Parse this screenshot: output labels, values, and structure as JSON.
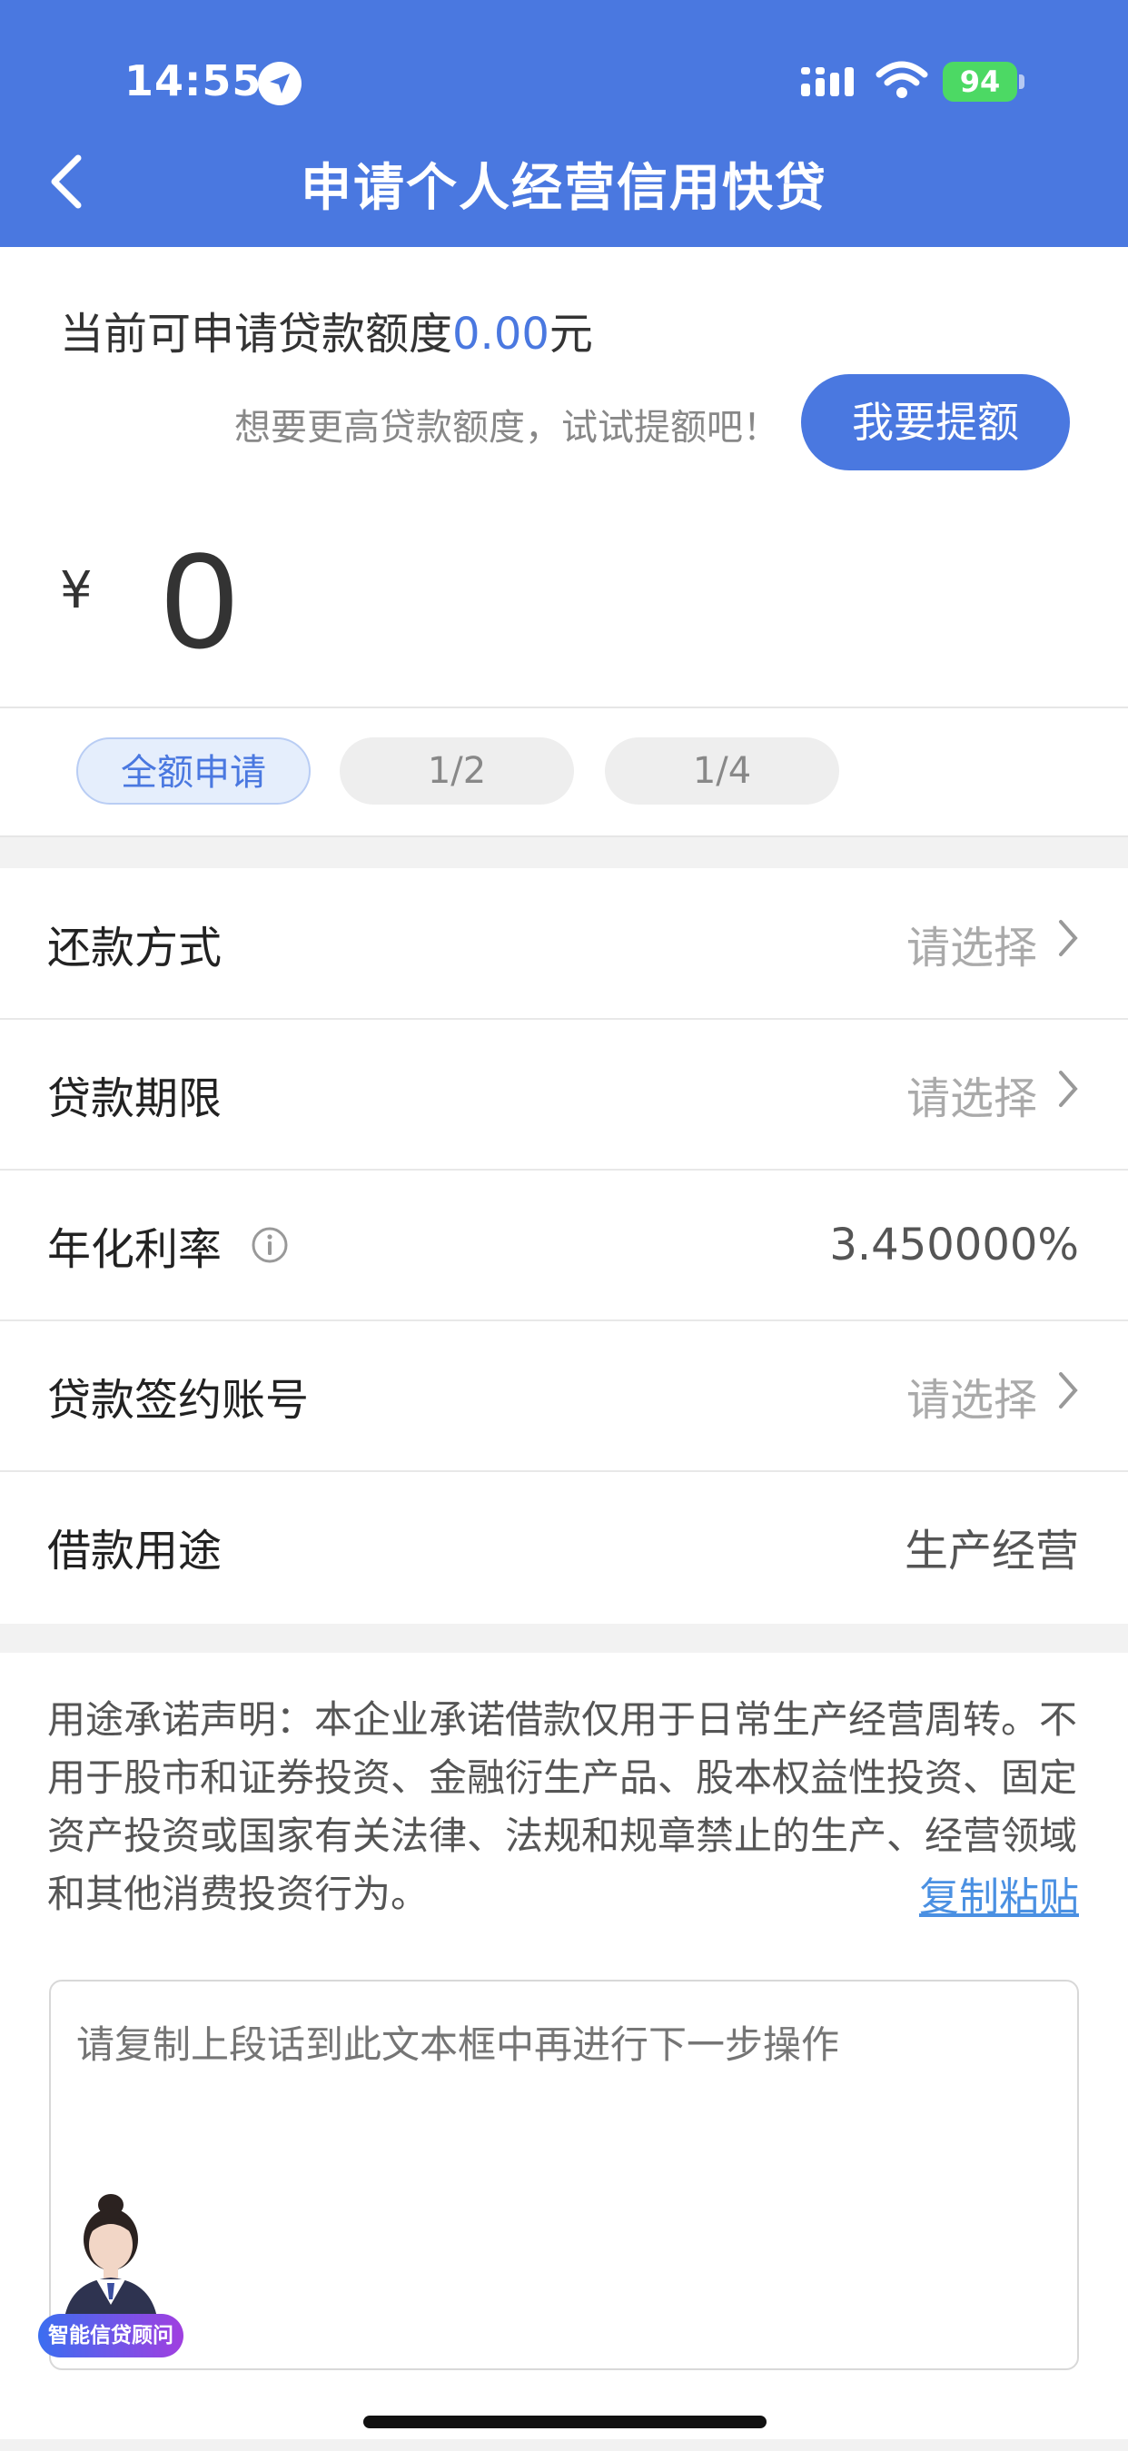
{
  "status_bar": {
    "time": "14:55",
    "battery": "94"
  },
  "header": {
    "title": "申请个人经营信用快贷"
  },
  "quota": {
    "prefix": "当前可申请贷款额度",
    "amount": "0.00",
    "unit": "元"
  },
  "raise": {
    "hint": "想要更高贷款额度，试试提额吧！",
    "button_label": "我要提额"
  },
  "amount": {
    "currency": "¥",
    "value": "0"
  },
  "chips": [
    {
      "label": "全额申请",
      "selected": true
    },
    {
      "label": "1/2",
      "selected": false
    },
    {
      "label": "1/4",
      "selected": false
    }
  ],
  "form": {
    "repayment": {
      "label": "还款方式",
      "value": "请选择"
    },
    "term": {
      "label": "贷款期限",
      "value": "请选择"
    },
    "rate": {
      "label": "年化利率",
      "value": "3.450000%"
    },
    "account": {
      "label": "贷款签约账号",
      "value": "请选择"
    },
    "purpose": {
      "label": "借款用途",
      "value": "生产经营"
    }
  },
  "declaration": {
    "text": "用途承诺声明：本企业承诺借款仅用于日常生产经营周转。不用于股市和证券投资、金融衍生产品、股本权益性投资、固定资产投资或国家有关法律、法规和规章禁止的生产、经营领域和其他消费投资行为。",
    "copy_label": "复制粘贴"
  },
  "textarea": {
    "placeholder": "请复制上段话到此文本框中再进行下一步操作"
  },
  "advisor": {
    "label": "智能信贷顾问"
  },
  "colors": {
    "primary": "#4a78e0",
    "link": "#4a90e2",
    "battery": "#4cd964"
  }
}
